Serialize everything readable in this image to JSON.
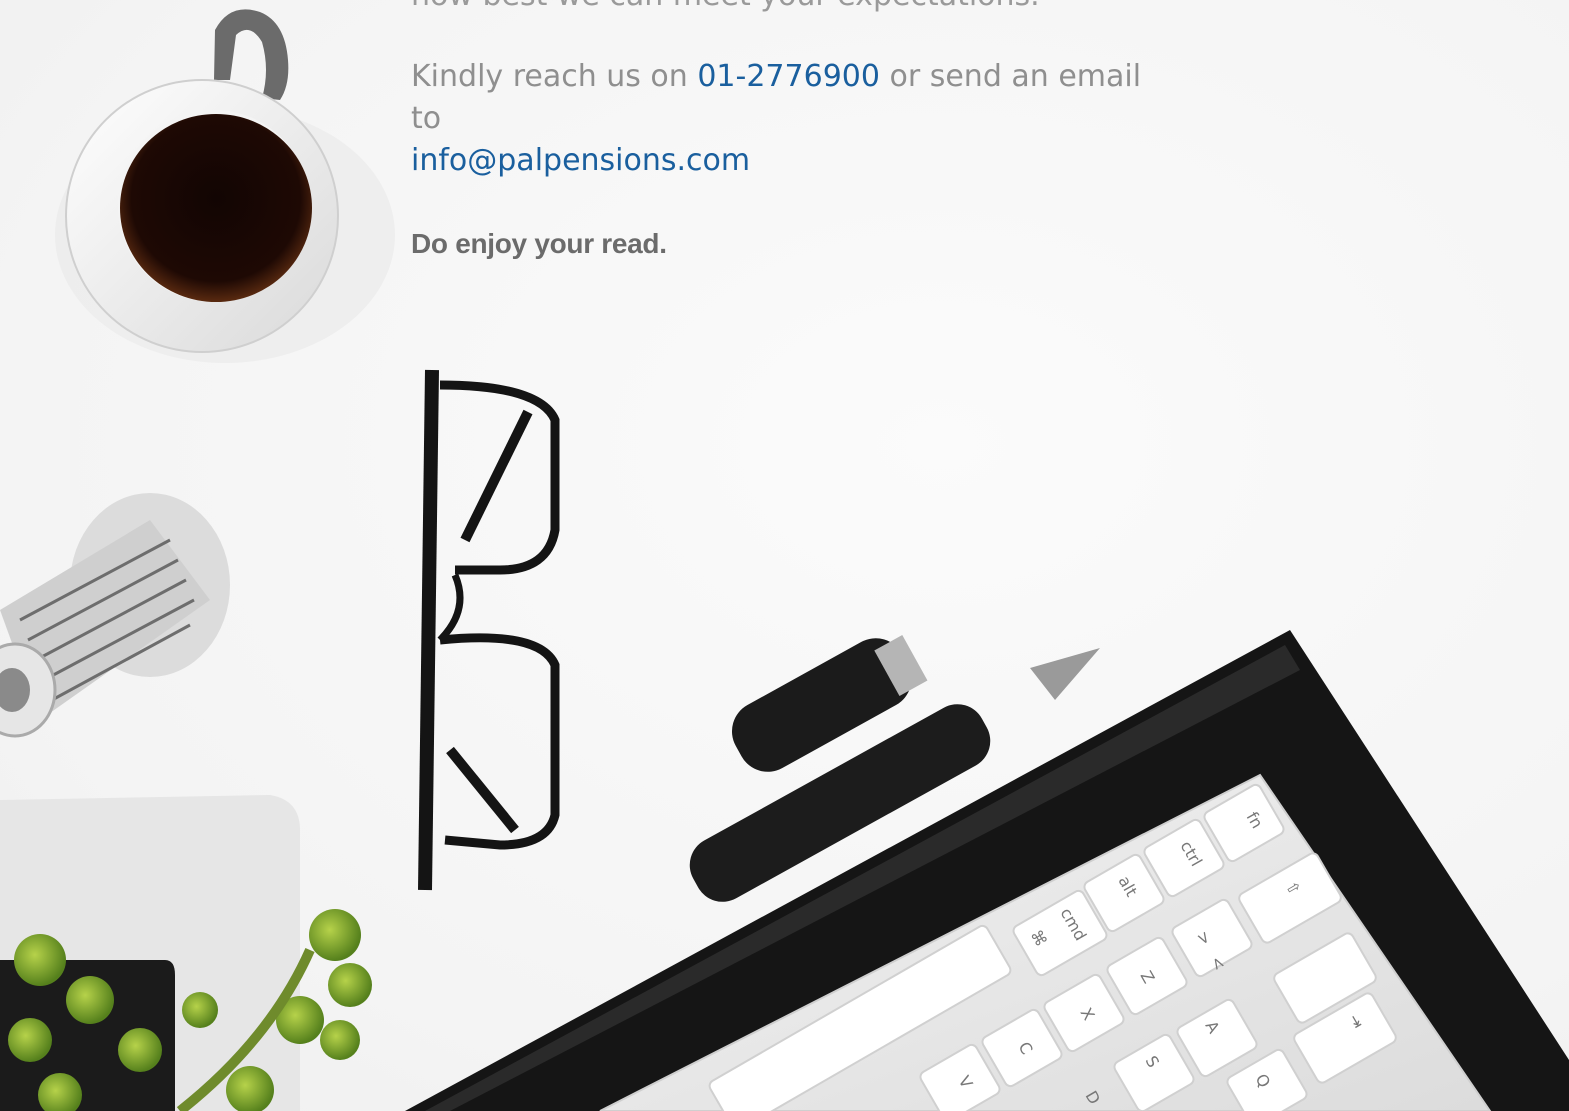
{
  "document": {
    "previous_line": "how best we can meet your expectations.",
    "contact_prefix": "Kindly reach us on",
    "phone": "01-2776900",
    "contact_middle": "or send an email to",
    "email": "info@palpensions.com",
    "closing": "Do enjoy your read."
  },
  "photo": {
    "objects": [
      "coffee-cup",
      "leaning-tower-figurine",
      "succulent-plant-pot",
      "eyeglasses",
      "pen-with-cap",
      "notebook",
      "keyboard"
    ]
  },
  "keyboard_keys": [
    "fn",
    "ctrl",
    "alt",
    "cmd",
    "⌘",
    "⇧",
    "Z",
    "X",
    "C",
    "V",
    "A",
    "S",
    "D",
    "Q",
    "<",
    ">",
    "⇥"
  ],
  "colors": {
    "link": "#1a5f9e",
    "body_text": "#8f8f8f",
    "closing_text": "#6b6b6b"
  }
}
